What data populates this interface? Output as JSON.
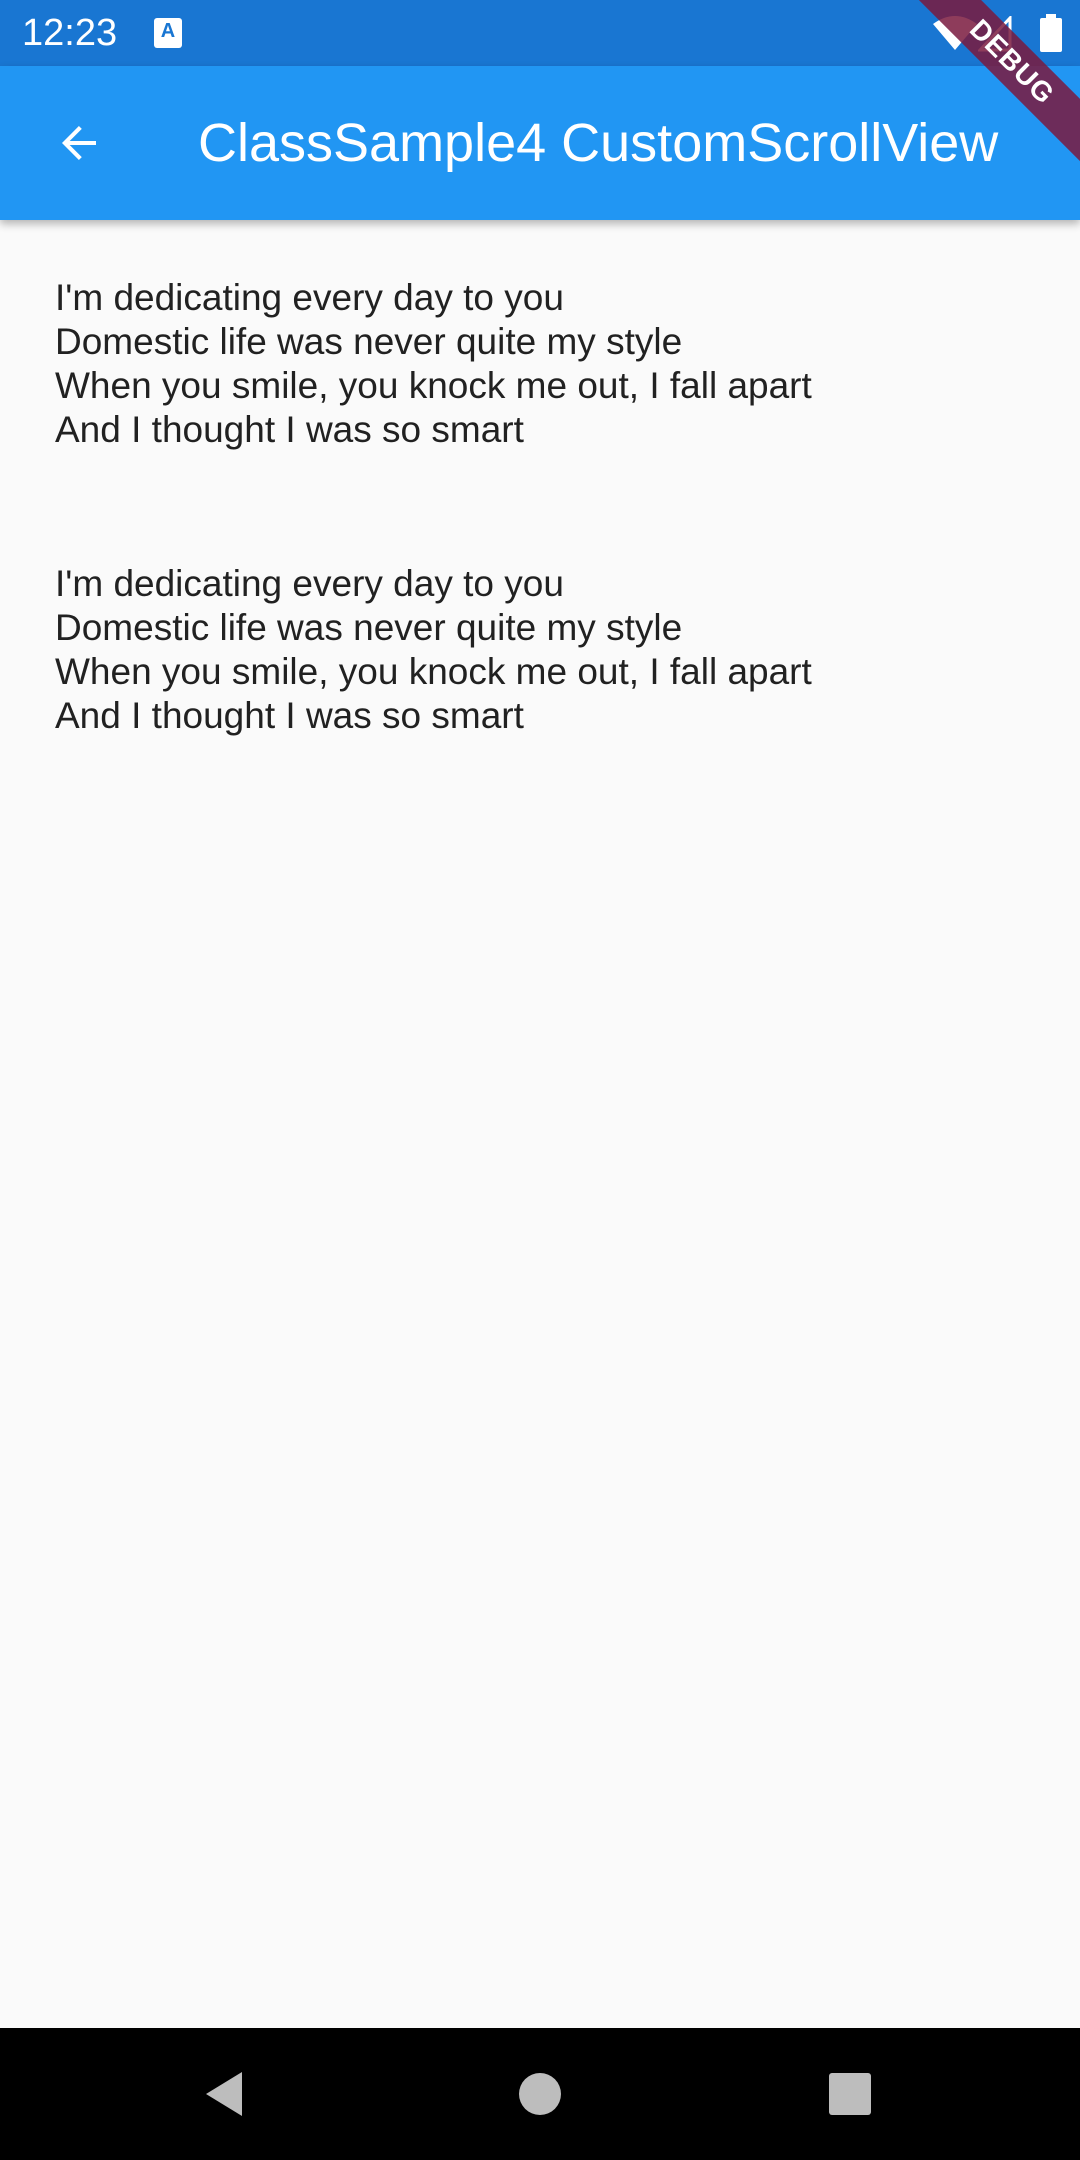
{
  "status_bar": {
    "time": "12:23",
    "notification_icon": "a-text-icon",
    "icons": [
      "wifi-icon",
      "signal-icon",
      "battery-icon"
    ],
    "background_color": "#1976d2"
  },
  "app_bar": {
    "title": "ClassSample4 CustomScrollView",
    "back_icon": "arrow-back-icon",
    "background_color": "#2196f3"
  },
  "debug_banner": {
    "label": "DEBUG",
    "color": "#7a1a3e"
  },
  "content": {
    "blocks": [
      {
        "lines": [
          "I'm dedicating every day to you",
          "Domestic life was never quite my style",
          "When you smile, you knock me out, I fall apart",
          "And I thought I was so smart"
        ]
      },
      {
        "lines": [
          "I'm dedicating every day to you",
          "Domestic life was never quite my style",
          "When you smile, you knock me out, I fall apart",
          "And I thought I was so smart"
        ]
      }
    ]
  },
  "nav_bar": {
    "buttons": [
      "nav-back-icon",
      "nav-home-icon",
      "nav-recents-icon"
    ]
  }
}
